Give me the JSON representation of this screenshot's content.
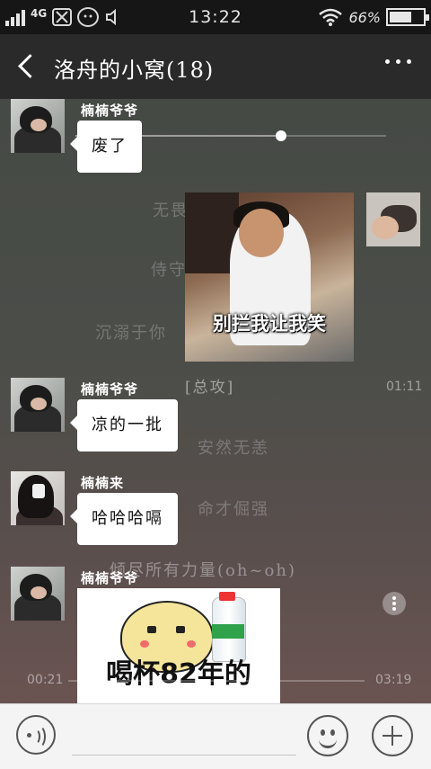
{
  "status_bar": {
    "network": "4G",
    "time": "13:22",
    "battery": "66%",
    "battery_level": 0.66,
    "icons": [
      "signal-icon",
      "scissors-icon",
      "wechat-icon",
      "speaker-icon",
      "wifi-icon",
      "battery-icon"
    ]
  },
  "header": {
    "title": "洛舟的小窝(18)",
    "back_icon": "back-arrow-icon",
    "more_icon": "more-dots-icon"
  },
  "background_video": {
    "lyrics": [
      "无畏",
      "侍守",
      "沉溺于你",
      "[总攻]",
      "安然无恙",
      "命才倔强",
      "倾尽所有力量(oh~oh)"
    ],
    "time_top": "01:11",
    "time_start": "00:21",
    "time_end": "03:19"
  },
  "messages": [
    {
      "sender": "楠楠爷爷",
      "type": "text",
      "content": "废了"
    },
    {
      "sender": "self",
      "type": "sticker",
      "caption": "别拦我让我笑"
    },
    {
      "sender": "楠楠爷爷",
      "type": "text",
      "content": "凉的一批"
    },
    {
      "sender": "楠楠来",
      "type": "text",
      "content": "哈哈哈嗝"
    },
    {
      "sender": "楠楠爷爷",
      "type": "sticker",
      "caption": "喝杯82年的"
    }
  ],
  "input_bar": {
    "placeholder": "",
    "voice_icon": "voice-icon",
    "emoji_icon": "emoji-icon",
    "plus_icon": "plus-icon"
  }
}
